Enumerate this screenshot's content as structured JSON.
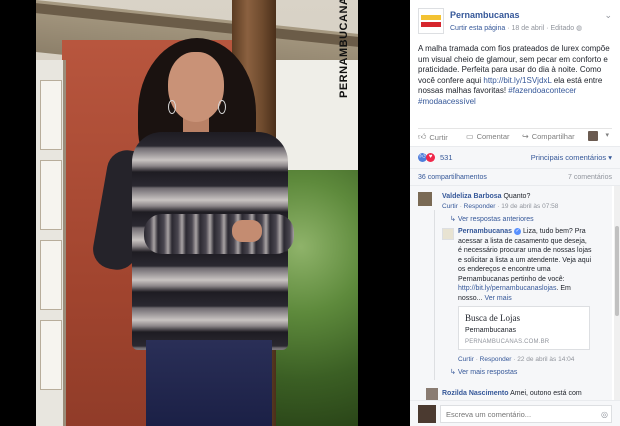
{
  "photo": {
    "brand_vertical": "PERNAMBUCANAS"
  },
  "post": {
    "page_name": "Pernambucanas",
    "like_page": "Curtir esta página",
    "date": "18 de abril",
    "edited": "Editado",
    "text_1": "A malha tramada com fios prateados de lurex compõe um visual cheio de glamour, sem pecar em conforto e praticidade. Perfeita para usar do dia à noite. Como você confere aqui ",
    "link_1": "http://bit.ly/1SVjdxL",
    "text_2": " ela está entre nossas malhas favoritas! ",
    "hashtags": "#fazendoacontecer #modaacessível"
  },
  "actions": {
    "like": "Curtir",
    "comment": "Comentar",
    "share": "Compartilhar"
  },
  "reactions": {
    "count": "531",
    "top_comments": "Principais comentários ▾"
  },
  "counts": {
    "shares": "36 compartilhamentos",
    "comments": "7 comentários"
  },
  "comment_1": {
    "name": "Valdeliza Barbosa",
    "text": "Quanto?",
    "like": "Curtir",
    "reply": "Responder",
    "time": "19 de abril às 07:58",
    "previous_replies": "Ver respostas anteriores"
  },
  "reply_1": {
    "name": "Pernambucanas",
    "text": "Liza, tudo bem? Pra acessar a lista de casamento que deseja, é necessário procurar uma de nossas lojas e solicitar a lista a um atendente. Veja aqui os endereços e encontre uma Pernambucanas pertinho de você: ",
    "link": "http://bit.ly/pernambucanaslojas",
    "text_end": ". Em nosso...",
    "see_more": "Ver mais",
    "card_title": "Busca de Lojas",
    "card_sub": "Pernambucanas",
    "card_url": "PERNAMBUCANAS.COM.BR",
    "like": "Curtir",
    "reply": "Responder",
    "time": "22 de abril às 14:04",
    "more_replies": "Ver mais respostas"
  },
  "comment_2": {
    "name": "Rozilda Nascimento",
    "text": "Amei, outono está com"
  },
  "write": {
    "placeholder": "Escreva um comentário..."
  }
}
